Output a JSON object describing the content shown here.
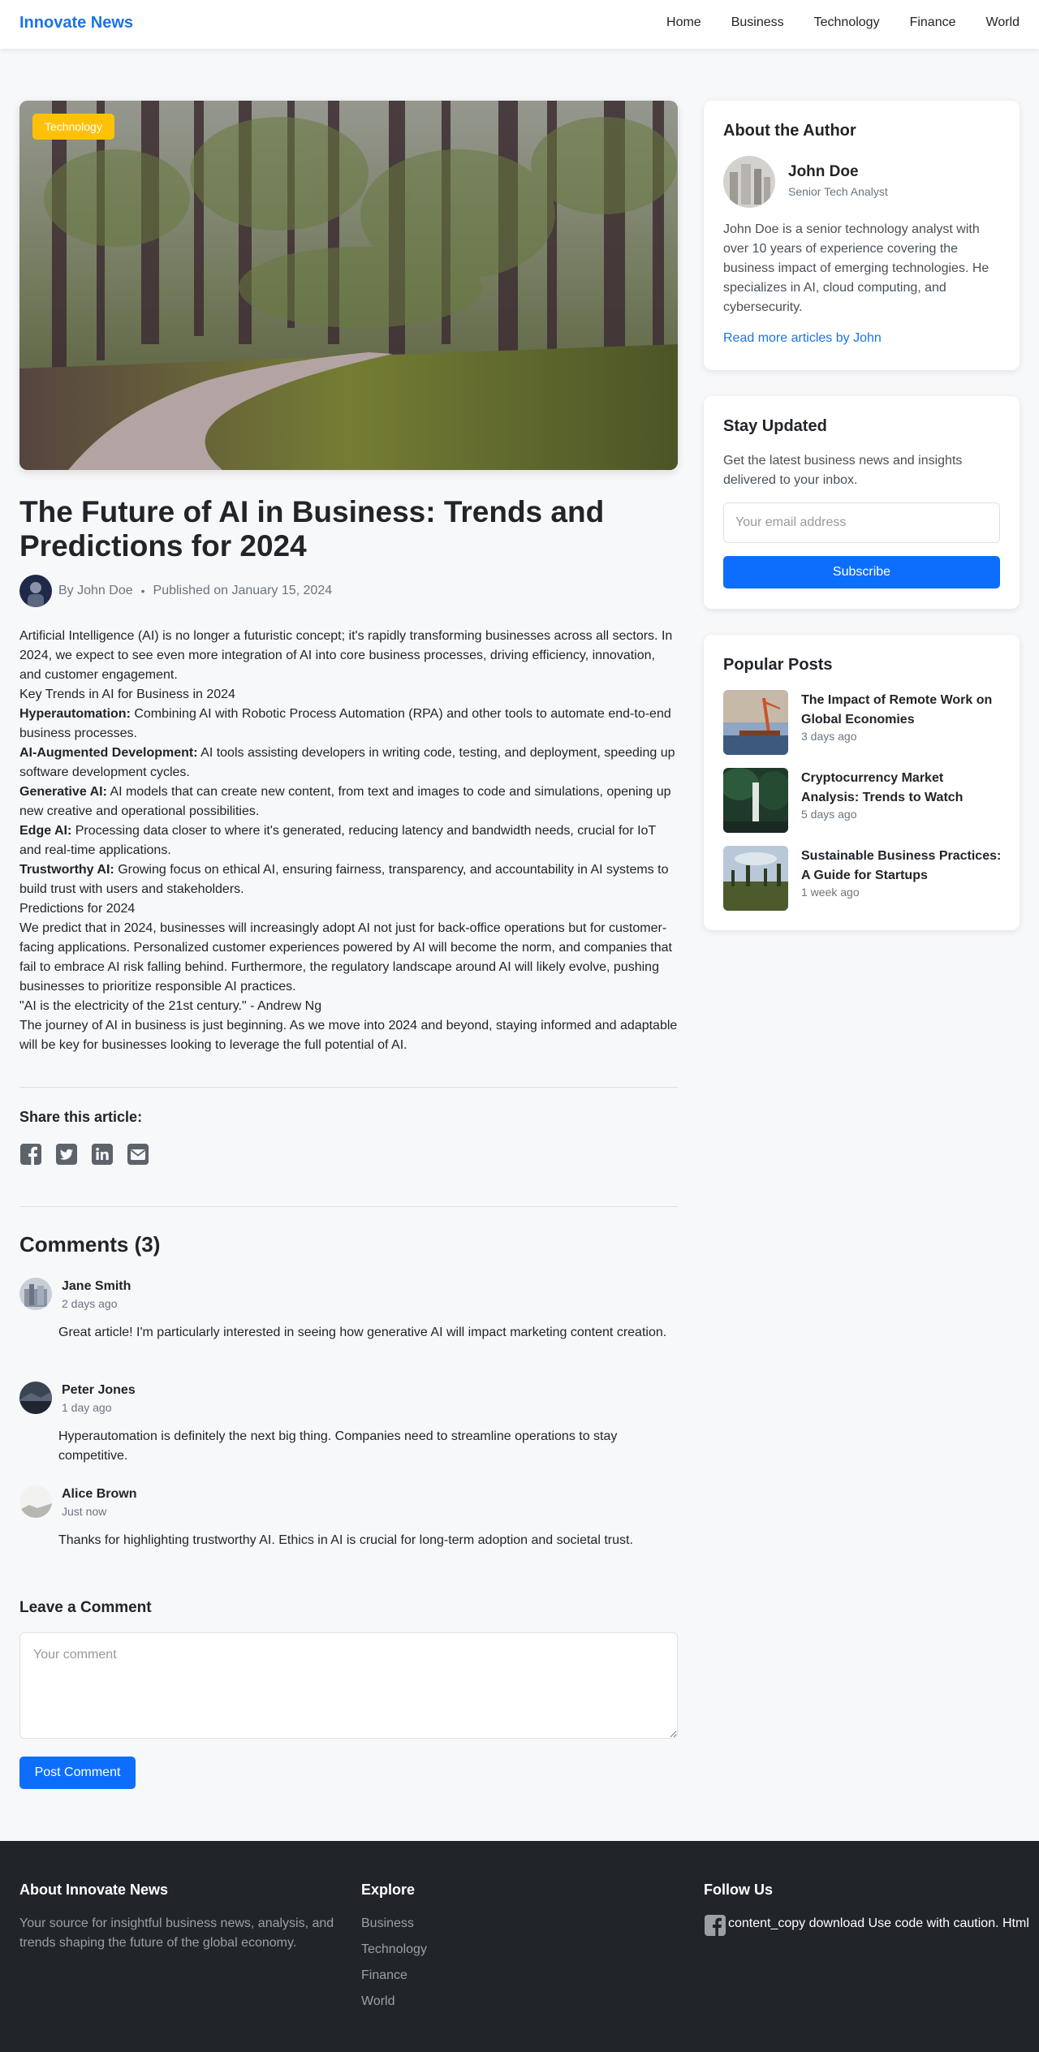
{
  "site": {
    "brand": "Innovate News",
    "accent": "#1a73e8"
  },
  "nav": {
    "items": [
      "Home",
      "Business",
      "Technology",
      "Finance",
      "World"
    ]
  },
  "article": {
    "category": "Technology",
    "title": "The Future of AI in Business: Trends and Predictions for 2024",
    "byline": "By John Doe",
    "separator": "•",
    "published": "Published on January 15, 2024",
    "intro": "Artificial Intelligence (AI) is no longer a futuristic concept; it's rapidly transforming businesses across all sectors. In 2024, we expect to see even more integration of AI into core business processes, driving efficiency, innovation, and customer engagement.",
    "trends_heading": "Key Trends in AI for Business in 2024",
    "trends": [
      {
        "term": "Hyperautomation:",
        "text": " Combining AI with Robotic Process Automation (RPA) and other tools to automate end-to-end business processes."
      },
      {
        "term": "AI-Augmented Development:",
        "text": " AI tools assisting developers in writing code, testing, and deployment, speeding up software development cycles."
      },
      {
        "term": "Generative AI:",
        "text": " AI models that can create new content, from text and images to code and simulations, opening up new creative and operational possibilities."
      },
      {
        "term": "Edge AI:",
        "text": " Processing data closer to where it's generated, reducing latency and bandwidth needs, crucial for IoT and real-time applications."
      },
      {
        "term": "Trustworthy AI:",
        "text": " Growing focus on ethical AI, ensuring fairness, transparency, and accountability in AI systems to build trust with users and stakeholders."
      }
    ],
    "predictions_heading": "Predictions for 2024",
    "predictions": "We predict that in 2024, businesses will increasingly adopt AI not just for back-office operations but for customer-facing applications. Personalized customer experiences powered by AI will become the norm, and companies that fail to embrace AI risk falling behind. Furthermore, the regulatory landscape around AI will likely evolve, pushing businesses to prioritize responsible AI practices.",
    "quote": "\"AI is the electricity of the 21st century.\" - Andrew Ng",
    "conclusion": "The journey of AI in business is just beginning. As we move into 2024 and beyond, staying informed and adaptable will be key for businesses looking to leverage the full potential of AI.",
    "badge_color": "#ffc107"
  },
  "share": {
    "heading": "Share this article:",
    "icons": [
      "facebook-icon",
      "twitter-icon",
      "linkedin-icon",
      "envelope-icon"
    ]
  },
  "comments": {
    "heading": "Comments (3)",
    "items": [
      {
        "name": "Jane Smith",
        "time": "2 days ago",
        "body": "Great article! I'm particularly interested in seeing how generative AI will impact marketing content creation."
      },
      {
        "name": "Peter Jones",
        "time": "1 day ago",
        "body": "Hyperautomation is definitely the next big thing. Companies need to streamline operations to stay competitive."
      },
      {
        "name": "Alice Brown",
        "time": "Just now",
        "body": "Thanks for highlighting trustworthy AI. Ethics in AI is crucial for long-term adoption and societal trust."
      }
    ],
    "form": {
      "heading": "Leave a Comment",
      "placeholder": "Your comment",
      "button": "Post Comment"
    }
  },
  "sidebar": {
    "author": {
      "heading": "About the Author",
      "name": "John Doe",
      "role": "Senior Tech Analyst",
      "bio": "John Doe is a senior technology analyst with over 10 years of experience covering the business impact of emerging technologies. He specializes in AI, cloud computing, and cybersecurity.",
      "link": "Read more articles by John"
    },
    "newsletter": {
      "heading": "Stay Updated",
      "text": "Get the latest business news and insights delivered to your inbox.",
      "placeholder": "Your email address",
      "button": "Subscribe"
    },
    "popular": {
      "heading": "Popular Posts",
      "items": [
        {
          "title": "The Impact of Remote Work on Global Economies",
          "time": "3 days ago"
        },
        {
          "title": "Cryptocurrency Market Analysis: Trends to Watch",
          "time": "5 days ago"
        },
        {
          "title": "Sustainable Business Practices: A Guide for Startups",
          "time": "1 week ago"
        }
      ]
    }
  },
  "footer": {
    "about_heading": "About Innovate News",
    "about_text": "Your source for insightful business news, analysis, and trends shaping the future of the global economy.",
    "explore_heading": "Explore",
    "explore_links": [
      "Business",
      "Technology",
      "Finance",
      "World"
    ],
    "follow_heading": "Follow Us",
    "follow_text": "content_copy download Use code with caution. Html"
  }
}
